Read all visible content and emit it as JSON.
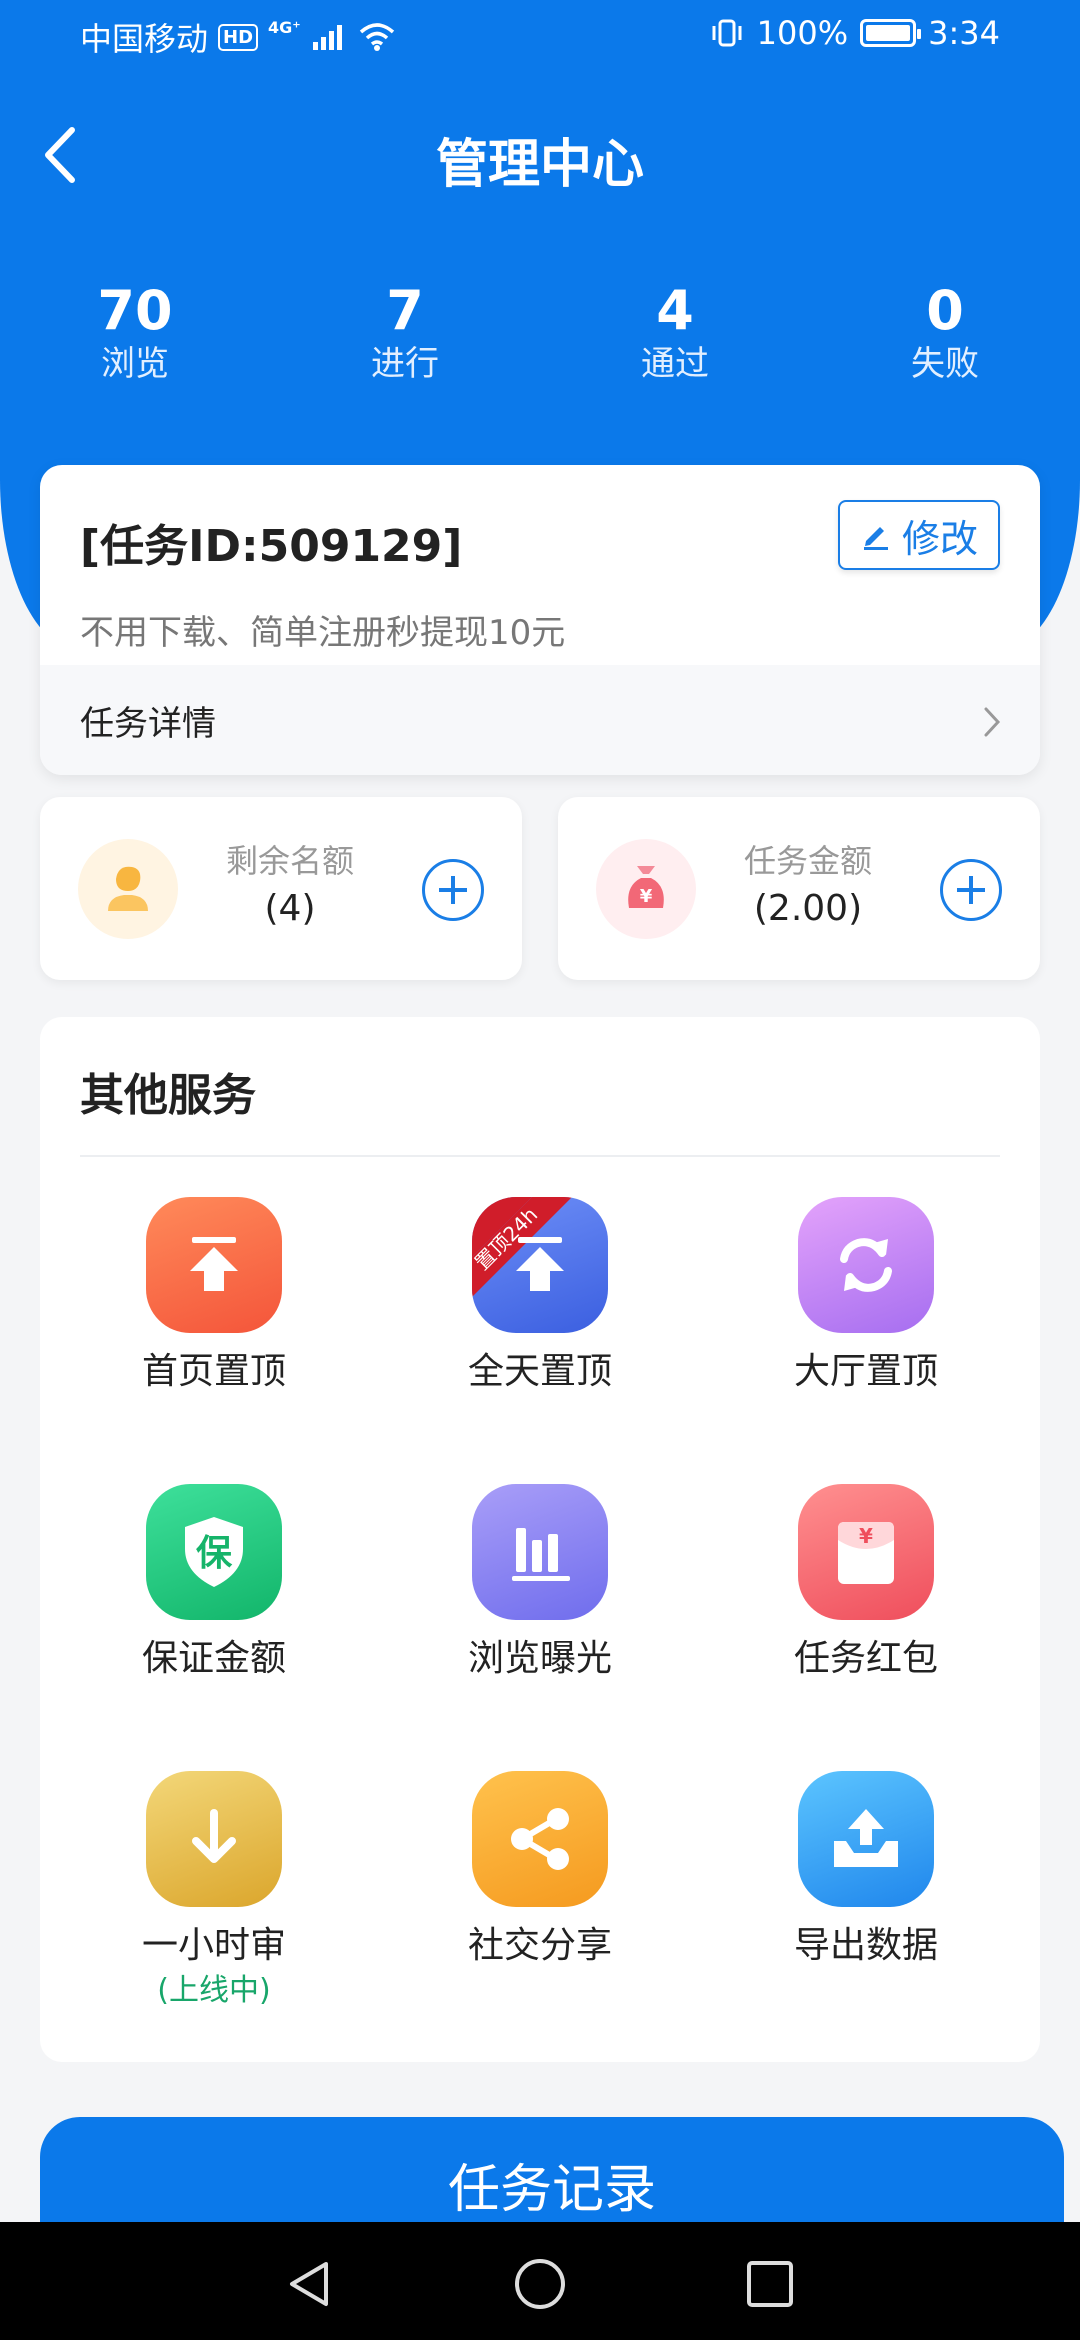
{
  "status_bar": {
    "carrier": "中国移动",
    "hd": "HD",
    "network": "4G⁺",
    "battery": "100%",
    "time": "3:34"
  },
  "header": {
    "title": "管理中心"
  },
  "stats": [
    {
      "value": "70",
      "label": "浏览"
    },
    {
      "value": "7",
      "label": "进行"
    },
    {
      "value": "4",
      "label": "通过"
    },
    {
      "value": "0",
      "label": "失败"
    }
  ],
  "task": {
    "id_text": "[任务ID:509129]",
    "edit_label": "修改",
    "description": "不用下载、简单注册秒提现10元",
    "detail_label": "任务详情"
  },
  "quota": {
    "label": "剩余名额",
    "value": "(4)"
  },
  "amount": {
    "label": "任务金额",
    "value": "(2.00)"
  },
  "services": {
    "title": "其他服务",
    "items": [
      {
        "label": "首页置顶",
        "icon": "home-top-icon"
      },
      {
        "label": "全天置顶",
        "icon": "allday-top-icon",
        "ribbon": "置顶24h"
      },
      {
        "label": "大厅置顶",
        "icon": "refresh-icon"
      },
      {
        "label": "保证金额",
        "icon": "shield-icon",
        "glyph": "保"
      },
      {
        "label": "浏览曝光",
        "icon": "bar-chart-icon"
      },
      {
        "label": "任务红包",
        "icon": "red-envelope-icon",
        "glyph": "¥"
      },
      {
        "label": "一小时审",
        "icon": "download-icon",
        "sub": "(上线中)"
      },
      {
        "label": "社交分享",
        "icon": "share-icon"
      },
      {
        "label": "导出数据",
        "icon": "export-icon"
      }
    ]
  },
  "record_button": "任务记录",
  "colors": {
    "primary": "#0b79ea",
    "accent_green": "#18a66a"
  }
}
